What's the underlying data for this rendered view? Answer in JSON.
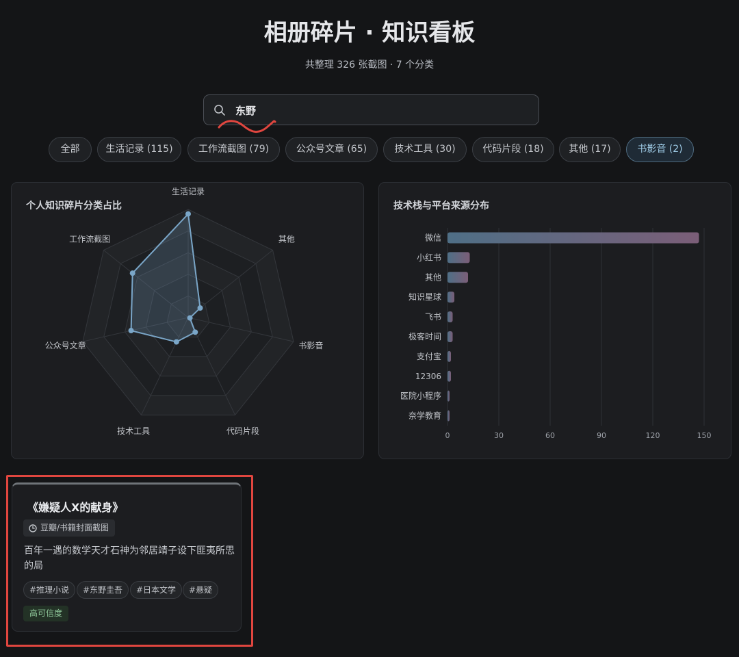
{
  "header": {
    "title": "相册碎片 · 知识看板",
    "subtitle": "共整理 326 张截图 · 7 个分类"
  },
  "search": {
    "value": "东野",
    "placeholder": ""
  },
  "filters": [
    {
      "label": "全部",
      "active": false
    },
    {
      "label": "生活记录 (115)",
      "active": false
    },
    {
      "label": "工作流截图 (79)",
      "active": false
    },
    {
      "label": "公众号文章 (65)",
      "active": false
    },
    {
      "label": "技术工具 (30)",
      "active": false
    },
    {
      "label": "代码片段 (18)",
      "active": false
    },
    {
      "label": "其他 (17)",
      "active": false
    },
    {
      "label": "书影音 (2)",
      "active": true
    }
  ],
  "radar_panel": {
    "title": "个人知识碎片分类占比"
  },
  "bar_panel": {
    "title": "技术栈与平台来源分布"
  },
  "chart_data": [
    {
      "type": "radar",
      "title": "个人知识碎片分类占比",
      "categories": [
        "生活记录",
        "其他",
        "书影音",
        "代码片段",
        "技术工具",
        "公众号文章",
        "工作流截图"
      ],
      "values": [
        115,
        17,
        2,
        18,
        30,
        65,
        79
      ],
      "range": [
        0,
        120
      ],
      "rings": 5,
      "color": "#7aa6c8"
    },
    {
      "type": "bar",
      "orientation": "horizontal",
      "title": "技术栈与平台来源分布",
      "categories": [
        "微信",
        "小红书",
        "其他",
        "知识星球",
        "飞书",
        "极客时间",
        "支付宝",
        "12306",
        "医院小程序",
        "奈学教育"
      ],
      "values": [
        147,
        13,
        12,
        4,
        3,
        3,
        2,
        2,
        1,
        1
      ],
      "xlim": [
        0,
        150
      ],
      "xticks": [
        0,
        30,
        60,
        90,
        120,
        150
      ],
      "grid": true,
      "color_start": "#4f6f86",
      "color_end": "#7b5e78"
    }
  ],
  "card": {
    "title": "《嫌疑人X的献身》",
    "source": "豆瓣/书籍封面截图",
    "description": "百年一遇的数学天才石神为邻居靖子设下匪夷所思的局",
    "tags": [
      "#推理小说",
      "#东野圭吾",
      "#日本文学",
      "#悬疑"
    ],
    "confidence": "高可信度"
  },
  "colors": {
    "background": "#141517",
    "panel": "#1c1d20",
    "accent": "#9ecbe6",
    "highlight_box": "#e0463f",
    "squiggle": "#e0463f"
  }
}
